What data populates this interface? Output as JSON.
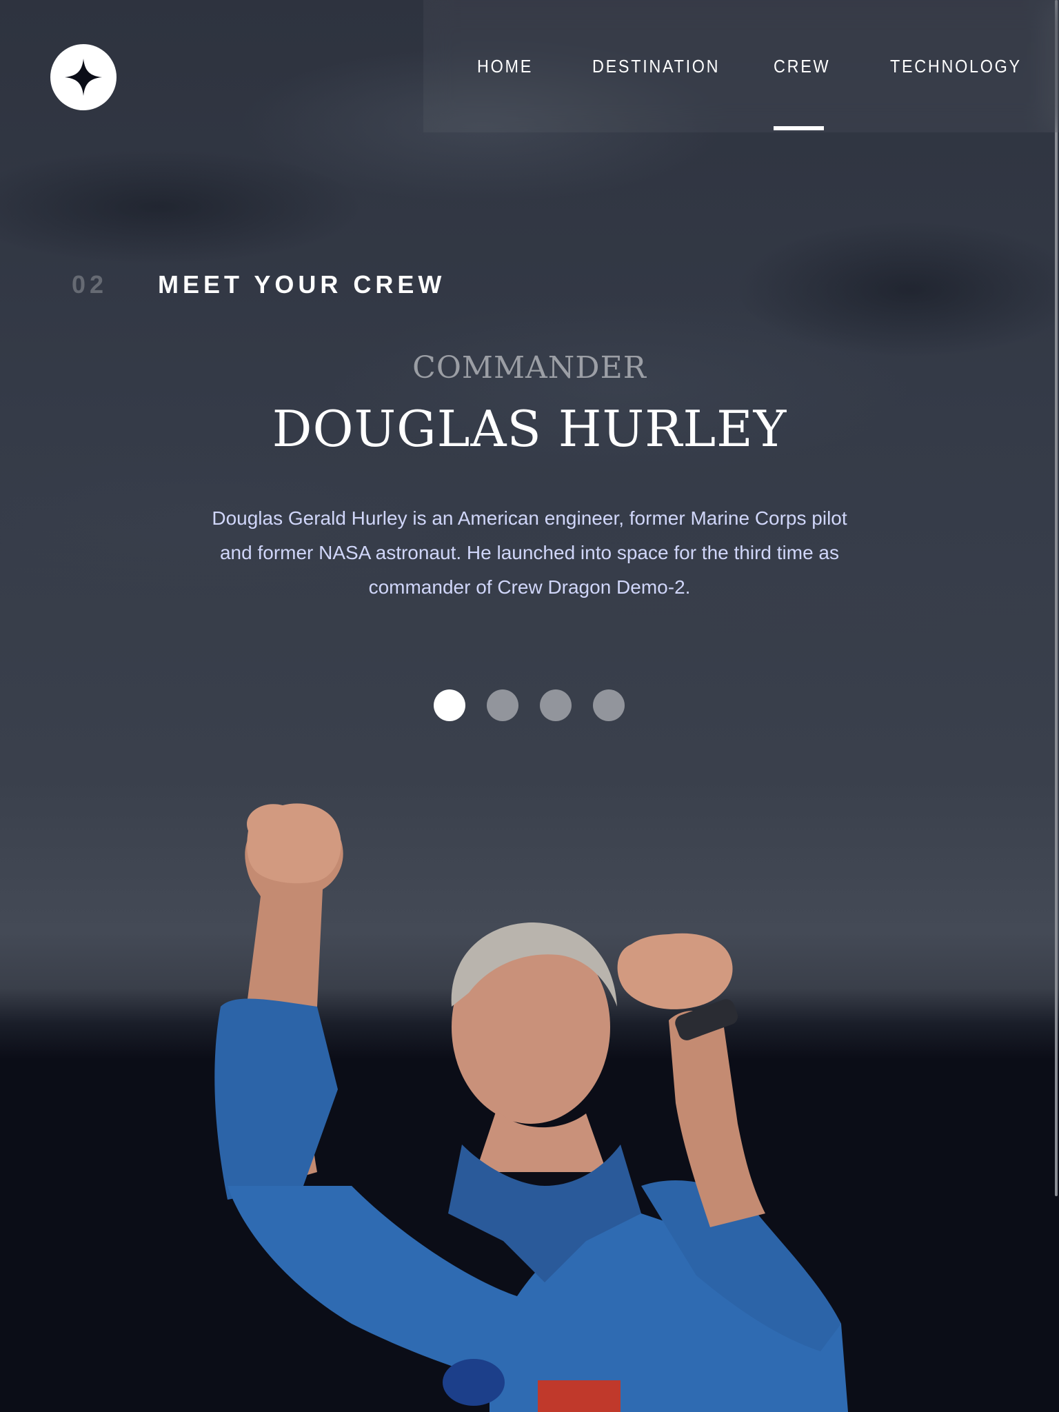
{
  "header": {
    "logo_icon": "star-logo-icon",
    "nav": [
      {
        "number": "",
        "label": "HOME",
        "active": false
      },
      {
        "number": "",
        "label": "DESTINATION",
        "active": false
      },
      {
        "number": "",
        "label": "CREW",
        "active": true
      },
      {
        "number": "",
        "label": "TECHNOLOGY",
        "active": false
      }
    ]
  },
  "page": {
    "section_number": "02",
    "section_title": "MEET YOUR CREW"
  },
  "crew": {
    "role": "COMMANDER",
    "name": "DOUGLAS HURLEY",
    "bio": "Douglas Gerald Hurley is an American engineer, former Marine Corps pilot and former NASA astronaut. He launched into space for the third time as commander of Crew Dragon Demo-2.",
    "slides": [
      {
        "active": true
      },
      {
        "active": false
      },
      {
        "active": false
      },
      {
        "active": false
      }
    ],
    "image": "crew-member-photo"
  },
  "colors": {
    "background": "#0b0d17",
    "text_light": "#d0d6f9",
    "white": "#ffffff"
  }
}
